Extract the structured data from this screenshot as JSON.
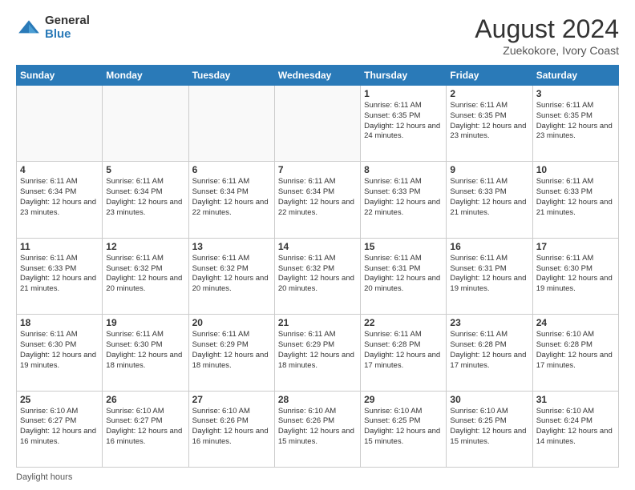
{
  "header": {
    "logo_general": "General",
    "logo_blue": "Blue",
    "month_year": "August 2024",
    "location": "Zuekokore, Ivory Coast"
  },
  "days_of_week": [
    "Sunday",
    "Monday",
    "Tuesday",
    "Wednesday",
    "Thursday",
    "Friday",
    "Saturday"
  ],
  "footer_note": "Daylight hours",
  "weeks": [
    [
      {
        "day": "",
        "info": ""
      },
      {
        "day": "",
        "info": ""
      },
      {
        "day": "",
        "info": ""
      },
      {
        "day": "",
        "info": ""
      },
      {
        "day": "1",
        "info": "Sunrise: 6:11 AM\nSunset: 6:35 PM\nDaylight: 12 hours\nand 24 minutes."
      },
      {
        "day": "2",
        "info": "Sunrise: 6:11 AM\nSunset: 6:35 PM\nDaylight: 12 hours\nand 23 minutes."
      },
      {
        "day": "3",
        "info": "Sunrise: 6:11 AM\nSunset: 6:35 PM\nDaylight: 12 hours\nand 23 minutes."
      }
    ],
    [
      {
        "day": "4",
        "info": "Sunrise: 6:11 AM\nSunset: 6:34 PM\nDaylight: 12 hours\nand 23 minutes."
      },
      {
        "day": "5",
        "info": "Sunrise: 6:11 AM\nSunset: 6:34 PM\nDaylight: 12 hours\nand 23 minutes."
      },
      {
        "day": "6",
        "info": "Sunrise: 6:11 AM\nSunset: 6:34 PM\nDaylight: 12 hours\nand 22 minutes."
      },
      {
        "day": "7",
        "info": "Sunrise: 6:11 AM\nSunset: 6:34 PM\nDaylight: 12 hours\nand 22 minutes."
      },
      {
        "day": "8",
        "info": "Sunrise: 6:11 AM\nSunset: 6:33 PM\nDaylight: 12 hours\nand 22 minutes."
      },
      {
        "day": "9",
        "info": "Sunrise: 6:11 AM\nSunset: 6:33 PM\nDaylight: 12 hours\nand 21 minutes."
      },
      {
        "day": "10",
        "info": "Sunrise: 6:11 AM\nSunset: 6:33 PM\nDaylight: 12 hours\nand 21 minutes."
      }
    ],
    [
      {
        "day": "11",
        "info": "Sunrise: 6:11 AM\nSunset: 6:33 PM\nDaylight: 12 hours\nand 21 minutes."
      },
      {
        "day": "12",
        "info": "Sunrise: 6:11 AM\nSunset: 6:32 PM\nDaylight: 12 hours\nand 20 minutes."
      },
      {
        "day": "13",
        "info": "Sunrise: 6:11 AM\nSunset: 6:32 PM\nDaylight: 12 hours\nand 20 minutes."
      },
      {
        "day": "14",
        "info": "Sunrise: 6:11 AM\nSunset: 6:32 PM\nDaylight: 12 hours\nand 20 minutes."
      },
      {
        "day": "15",
        "info": "Sunrise: 6:11 AM\nSunset: 6:31 PM\nDaylight: 12 hours\nand 20 minutes."
      },
      {
        "day": "16",
        "info": "Sunrise: 6:11 AM\nSunset: 6:31 PM\nDaylight: 12 hours\nand 19 minutes."
      },
      {
        "day": "17",
        "info": "Sunrise: 6:11 AM\nSunset: 6:30 PM\nDaylight: 12 hours\nand 19 minutes."
      }
    ],
    [
      {
        "day": "18",
        "info": "Sunrise: 6:11 AM\nSunset: 6:30 PM\nDaylight: 12 hours\nand 19 minutes."
      },
      {
        "day": "19",
        "info": "Sunrise: 6:11 AM\nSunset: 6:30 PM\nDaylight: 12 hours\nand 18 minutes."
      },
      {
        "day": "20",
        "info": "Sunrise: 6:11 AM\nSunset: 6:29 PM\nDaylight: 12 hours\nand 18 minutes."
      },
      {
        "day": "21",
        "info": "Sunrise: 6:11 AM\nSunset: 6:29 PM\nDaylight: 12 hours\nand 18 minutes."
      },
      {
        "day": "22",
        "info": "Sunrise: 6:11 AM\nSunset: 6:28 PM\nDaylight: 12 hours\nand 17 minutes."
      },
      {
        "day": "23",
        "info": "Sunrise: 6:11 AM\nSunset: 6:28 PM\nDaylight: 12 hours\nand 17 minutes."
      },
      {
        "day": "24",
        "info": "Sunrise: 6:10 AM\nSunset: 6:28 PM\nDaylight: 12 hours\nand 17 minutes."
      }
    ],
    [
      {
        "day": "25",
        "info": "Sunrise: 6:10 AM\nSunset: 6:27 PM\nDaylight: 12 hours\nand 16 minutes."
      },
      {
        "day": "26",
        "info": "Sunrise: 6:10 AM\nSunset: 6:27 PM\nDaylight: 12 hours\nand 16 minutes."
      },
      {
        "day": "27",
        "info": "Sunrise: 6:10 AM\nSunset: 6:26 PM\nDaylight: 12 hours\nand 16 minutes."
      },
      {
        "day": "28",
        "info": "Sunrise: 6:10 AM\nSunset: 6:26 PM\nDaylight: 12 hours\nand 15 minutes."
      },
      {
        "day": "29",
        "info": "Sunrise: 6:10 AM\nSunset: 6:25 PM\nDaylight: 12 hours\nand 15 minutes."
      },
      {
        "day": "30",
        "info": "Sunrise: 6:10 AM\nSunset: 6:25 PM\nDaylight: 12 hours\nand 15 minutes."
      },
      {
        "day": "31",
        "info": "Sunrise: 6:10 AM\nSunset: 6:24 PM\nDaylight: 12 hours\nand 14 minutes."
      }
    ]
  ]
}
